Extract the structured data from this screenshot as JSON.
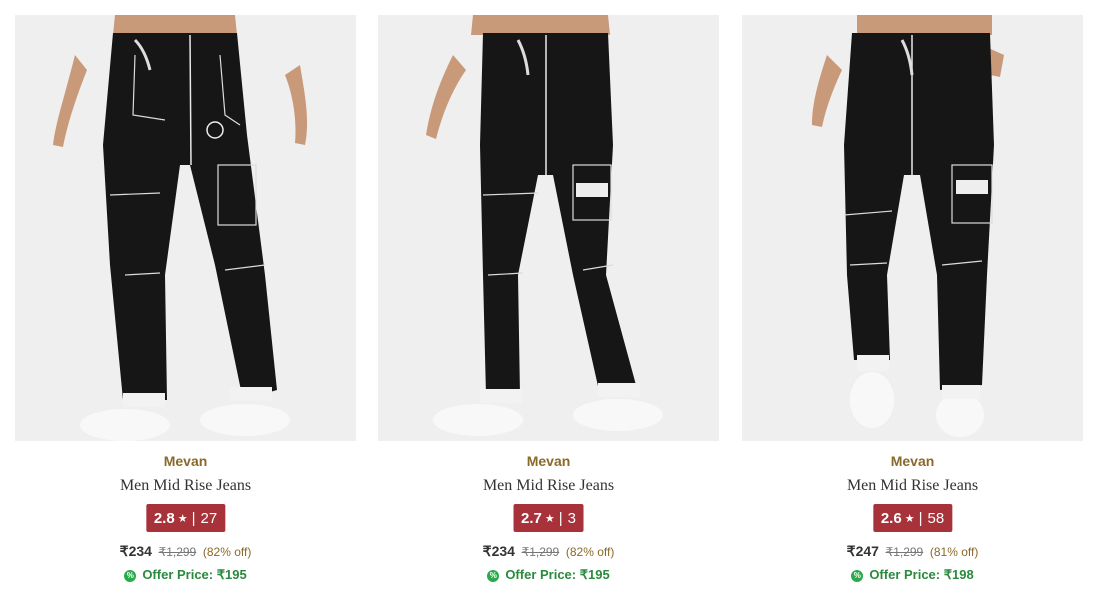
{
  "colors": {
    "image_bg": "#efefef",
    "brand": "#8a6a2a",
    "rating_badge": "#a8323a",
    "offer": "#2a8a3e"
  },
  "products": [
    {
      "brand": "Mevan",
      "name": "Men Mid Rise Jeans",
      "rating": "2.8",
      "rating_star": "★",
      "rating_sep": "|",
      "rating_count": "27",
      "price": "₹234",
      "mrp": "₹1,299",
      "discount": "(82% off)",
      "offer_icon": "%",
      "offer_label": "Offer Price: ₹195"
    },
    {
      "brand": "Mevan",
      "name": "Men Mid Rise Jeans",
      "rating": "2.7",
      "rating_star": "★",
      "rating_sep": "|",
      "rating_count": "3",
      "price": "₹234",
      "mrp": "₹1,299",
      "discount": "(82% off)",
      "offer_icon": "%",
      "offer_label": "Offer Price: ₹195"
    },
    {
      "brand": "Mevan",
      "name": "Men Mid Rise Jeans",
      "rating": "2.6",
      "rating_star": "★",
      "rating_sep": "|",
      "rating_count": "58",
      "price": "₹247",
      "mrp": "₹1,299",
      "discount": "(81% off)",
      "offer_icon": "%",
      "offer_label": "Offer Price: ₹198"
    }
  ]
}
